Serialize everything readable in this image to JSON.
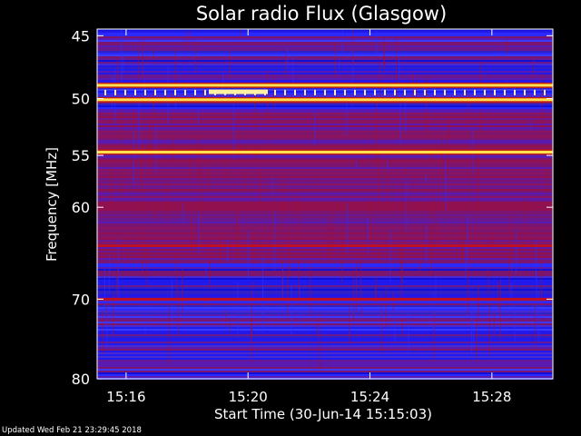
{
  "chart_data": {
    "type": "heatmap",
    "title": "Solar radio Flux (Glasgow)",
    "xlabel": "Start Time (30-Jun-14 15:15:03)",
    "ylabel": "Frequency [MHz]",
    "y_ticks": [
      45,
      50,
      55,
      60,
      70,
      80
    ],
    "y_scale": "log",
    "ylim": [
      44.5,
      80
    ],
    "x_ticks": [
      "15:16",
      "15:20",
      "15:24",
      "15:28"
    ],
    "xlim": [
      "15:15:03",
      "15:30:00"
    ],
    "colormap": "blue-red-yellow (low to high flux)",
    "bright_bands_mhz": [
      48.9,
      50.1,
      54.7
    ],
    "moderate_bands_mhz": [
      64,
      70
    ]
  },
  "footer": "Updated Wed Feb 21 23:29:45 2018",
  "colors": {
    "background": "#000000",
    "low": "#1a1aff",
    "mid": "#b01020",
    "high": "#ffe050"
  }
}
